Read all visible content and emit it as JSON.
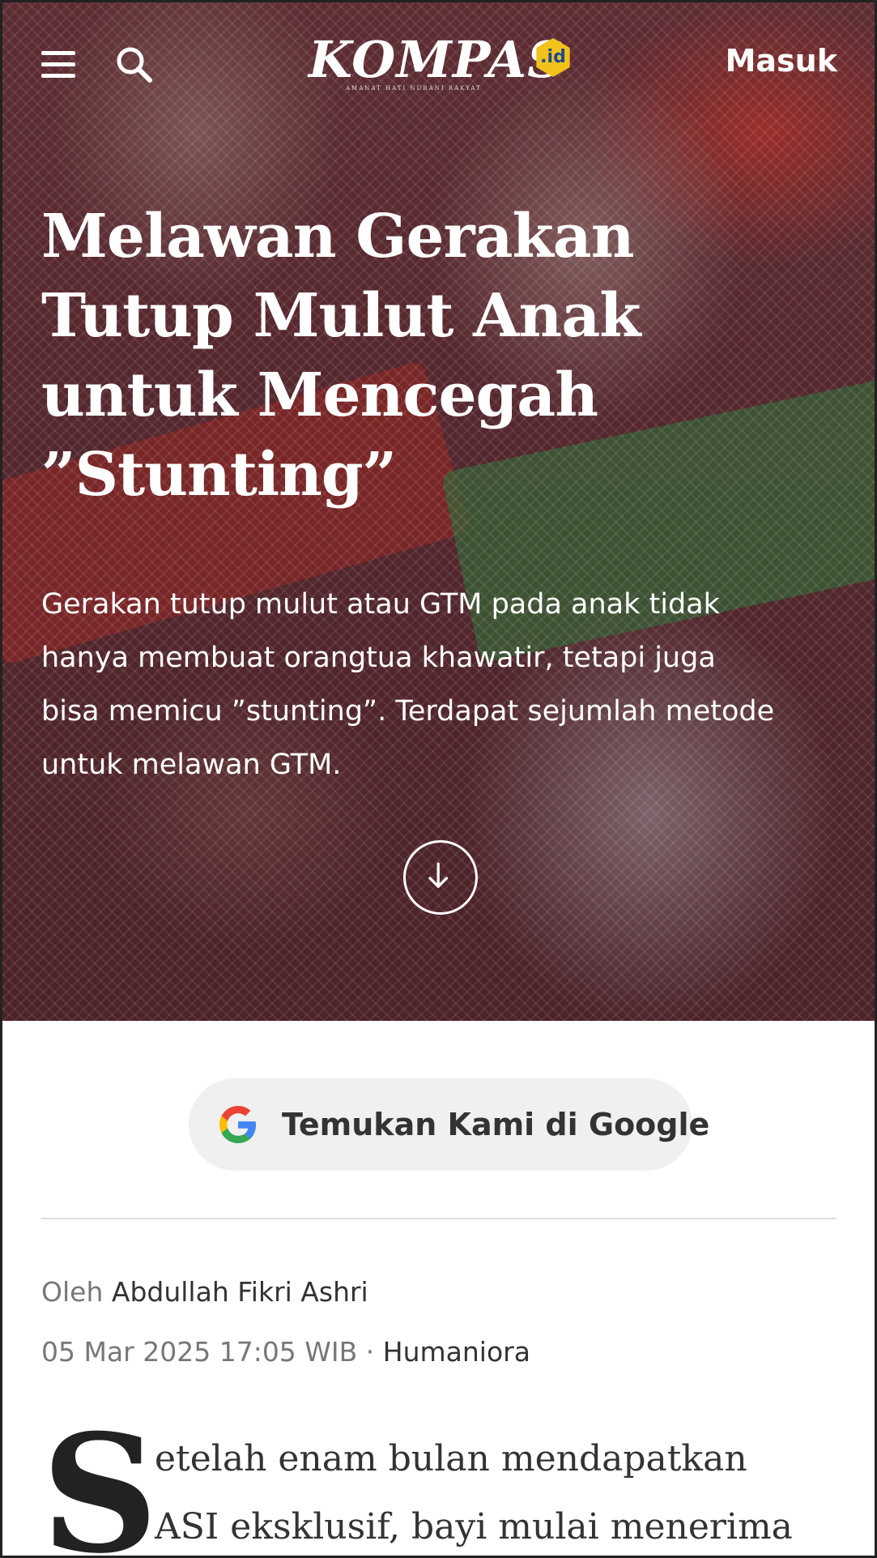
{
  "header": {
    "logo_text": "KOMPAS",
    "logo_badge": ".id",
    "logo_tagline": "AMANAT HATI NURANI RAKYAT",
    "login_label": "Masuk"
  },
  "hero": {
    "headline_lines": [
      "Melawan Gerakan",
      "Tutup Mulut Anak",
      "untuk Mencegah",
      "”Stunting”"
    ],
    "lede_lines": [
      "Gerakan tutup mulut atau GTM pada anak tidak",
      "hanya membuat orangtua khawatir, tetapi juga",
      "bisa memicu ”stunting”. Terdapat sejumlah metode",
      "untuk melawan GTM."
    ]
  },
  "google_button": {
    "label": "Temukan Kami di Google"
  },
  "article": {
    "byline_prefix": "Oleh",
    "author": "Abdullah Fikri Ashri",
    "date": "05 Mar 2025 17:05 WIB",
    "separator": "·",
    "category": "Humaniora",
    "dropcap": "S",
    "first_lines": [
      "etelah enam bulan mendapatkan",
      "ASI eksklusif, bayi mulai menerima"
    ]
  },
  "colors": {
    "google_blue": "#4285F4",
    "google_red": "#EA4335",
    "google_yellow": "#FBBC05",
    "google_green": "#34A853",
    "logo_badge": "#f2c21b"
  },
  "icons": {
    "menu": "hamburger-menu-icon",
    "search": "search-icon",
    "scroll": "arrow-down-circle-icon",
    "google": "google-g-icon"
  }
}
